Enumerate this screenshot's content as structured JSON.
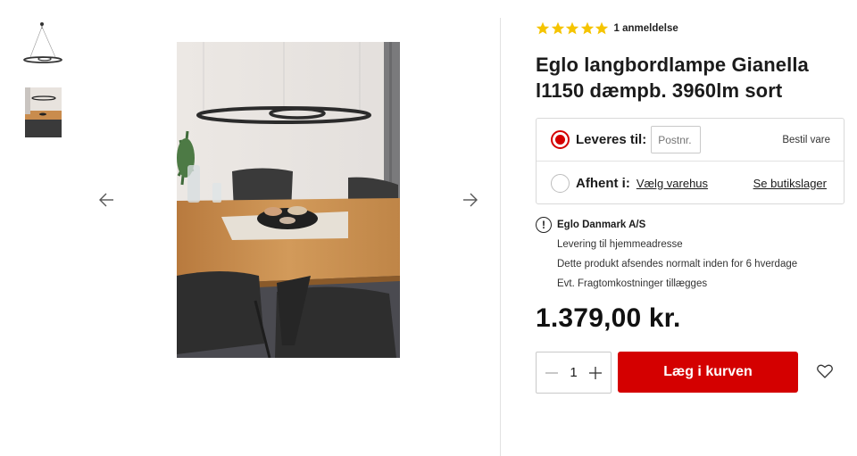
{
  "gallery": {
    "thumbnails": [
      "lamp-thumbnail",
      "room-thumbnail"
    ],
    "prev_icon": "arrow-left-icon",
    "next_icon": "arrow-right-icon"
  },
  "product": {
    "rating_stars": 5,
    "review_count": "1 anmeldelse",
    "title": "Eglo langbordlampe Gianella l1150 dæmpb. 3960lm sort",
    "price": "1.379,00 kr."
  },
  "delivery": {
    "deliver_label": "Leveres til:",
    "postnr_placeholder": "Postnr.",
    "order_text": "Bestil vare",
    "pickup_label": "Afhent i:",
    "choose_store": "Vælg varehus",
    "stock_link": "Se butikslager"
  },
  "info": {
    "supplier": "Eglo Danmark A/S",
    "lines": [
      "Levering til hjemmeadresse",
      "Dette produkt afsendes normalt inden for 6 hverdage",
      "Evt. Fragtomkostninger tillægges"
    ]
  },
  "cart": {
    "quantity": "1",
    "add_label": "Læg i kurven"
  },
  "colors": {
    "accent": "#d40000",
    "star": "#f5c400"
  }
}
